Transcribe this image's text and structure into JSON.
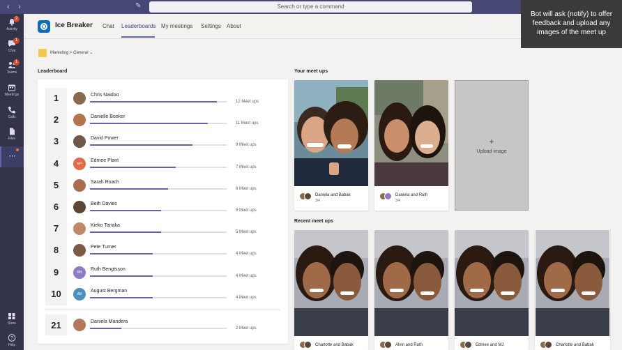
{
  "topbar": {
    "search_placeholder": "Search or type a command"
  },
  "rail": {
    "items": [
      {
        "label": "Activity",
        "icon": "bell-icon",
        "badge": "2"
      },
      {
        "label": "Chat",
        "icon": "chat-icon",
        "badge": "1"
      },
      {
        "label": "Teams",
        "icon": "teams-icon",
        "badge": "1"
      },
      {
        "label": "Meetings",
        "icon": "calendar-icon",
        "badge": ""
      },
      {
        "label": "Calls",
        "icon": "phone-icon",
        "badge": ""
      },
      {
        "label": "Files",
        "icon": "file-icon",
        "badge": ""
      }
    ],
    "more": "···",
    "store": "Store",
    "help": "Help"
  },
  "app": {
    "name": "Ice Breaker",
    "tabs": [
      "Chat",
      "Leaderboards",
      "My meetings",
      "Settings",
      "About"
    ],
    "active_tab": "Leaderboards"
  },
  "breadcrumb": "Marketing > General ⌄",
  "leaderboard": {
    "title": "Leaderboard",
    "rows": [
      {
        "rank": "1",
        "name": "Chris Naidoo",
        "meetups": "12 Meet ups",
        "progress": 0.93,
        "initials": "",
        "color": "#8a6a4c"
      },
      {
        "rank": "2",
        "name": "Danielle Booker",
        "meetups": "11 Meet ups",
        "progress": 0.86,
        "initials": "",
        "color": "#b4744e"
      },
      {
        "rank": "3",
        "name": "David Power",
        "meetups": "9 Meet ups",
        "progress": 0.75,
        "initials": "",
        "color": "#6e5848"
      },
      {
        "rank": "4",
        "name": "Edmee Plant",
        "meetups": "7 Meet ups",
        "progress": 0.63,
        "initials": "EP",
        "color": "#e06c4c"
      },
      {
        "rank": "5",
        "name": "Sarah Roach",
        "meetups": "6 Meet ups",
        "progress": 0.57,
        "initials": "",
        "color": "#a86e50"
      },
      {
        "rank": "6",
        "name": "Beth Davies",
        "meetups": "5 Meet ups",
        "progress": 0.52,
        "initials": "",
        "color": "#5e4636"
      },
      {
        "rank": "7",
        "name": "Kieko Tanaka",
        "meetups": "5 Meet ups",
        "progress": 0.52,
        "initials": "",
        "color": "#c08a66"
      },
      {
        "rank": "8",
        "name": "Pete Turner",
        "meetups": "4 Meet ups",
        "progress": 0.46,
        "initials": "",
        "color": "#7c5a44"
      },
      {
        "rank": "9",
        "name": "Ruth Bengtsson",
        "meetups": "4 Meet ups",
        "progress": 0.46,
        "initials": "RB",
        "color": "#8e7cc3"
      },
      {
        "rank": "10",
        "name": "August Bergman",
        "meetups": "4 Meet ups",
        "progress": 0.46,
        "initials": "AB",
        "color": "#4f8fc0"
      }
    ],
    "self": {
      "rank": "21",
      "name": "Daniela Mandera",
      "meetups": "2 Meet ups",
      "progress": 0.23,
      "color": "#b07a5a"
    }
  },
  "your_meetups": {
    "title": "Your meet ups",
    "cards": [
      {
        "caption": "Daniela and Babak",
        "sub": "3/4"
      },
      {
        "caption": "Daniela and Ruth",
        "sub": "3/4"
      }
    ],
    "upload_plus": "+",
    "upload_label": "Upload image"
  },
  "recent_meetups": {
    "title": "Recent meet ups",
    "cards": [
      {
        "caption": "Charlotte and Babak"
      },
      {
        "caption": "Alvin and Ruth"
      },
      {
        "caption": "Edmee and MJ"
      },
      {
        "caption": "Charlotte and Babak"
      }
    ]
  },
  "tooltip": "Bot will ask (notify) to offer feedback and upload any images of the meet up",
  "colors": {
    "brand": "#6264a7",
    "topbar": "#464775",
    "rail": "#33344a",
    "badge": "#cc4a31"
  }
}
